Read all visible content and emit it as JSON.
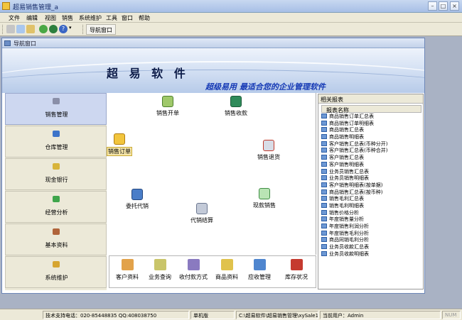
{
  "window": {
    "title": "超易销售管理_a"
  },
  "menu": [
    "文件",
    "编辑",
    "视图",
    "销售",
    "系统维护",
    "工具",
    "窗口",
    "帮助"
  ],
  "toolbar": {
    "nav_window_label": "导航窗口"
  },
  "child": {
    "title": "导航窗口"
  },
  "banner": {
    "brand": "超 易 软 件",
    "slogan": "超级易用  最适合您的企业管理软件"
  },
  "leftnav": [
    "销售管理",
    "仓库管理",
    "现金银行",
    "经营分析",
    "基本资料",
    "系统维护"
  ],
  "work": {
    "items": [
      "销售开单",
      "销售收款",
      "销售订单",
      "销售退货",
      "委托代销",
      "代销结算",
      "现款销售"
    ]
  },
  "bottom": [
    "客户资料",
    "业务查询",
    "收付款方式",
    "商品资料",
    "应收管理",
    "库存状况"
  ],
  "reports": {
    "header": "相关报表",
    "column": "报表名称",
    "items": [
      "商品销售订单汇总表",
      "商品销售订单明细表",
      "商品销售汇总表",
      "商品销售明细表",
      "客户销售汇总表(币种分开)",
      "客户销售汇总表(币种合并)",
      "客户销售汇总表",
      "客户销售明细表",
      "业务员销售汇总表",
      "业务员销售明细表",
      "客户销售明细表(按单据)",
      "商品销售汇总表(按币种)",
      "销售毛利汇总表",
      "销售毛利明细表",
      "销售价格分析",
      "年度销售量分析",
      "年度销售利润分析",
      "年度销售毛利分析",
      "商品同销毛利分析",
      "业务员收款汇总表",
      "业务员收款明细表"
    ]
  },
  "status": {
    "support": "技术支持电话：020-85448835 QQ:408038750",
    "edition": "单机版",
    "path": "C:\\超易软件\\超易销售管理\\xySale1.sys",
    "user": "当前用户：Admin",
    "num": "NUM"
  },
  "colors": {
    "banner_text": "#0e1d4a",
    "slogan": "#1539b5",
    "nav_active": "#cdd7f0"
  }
}
